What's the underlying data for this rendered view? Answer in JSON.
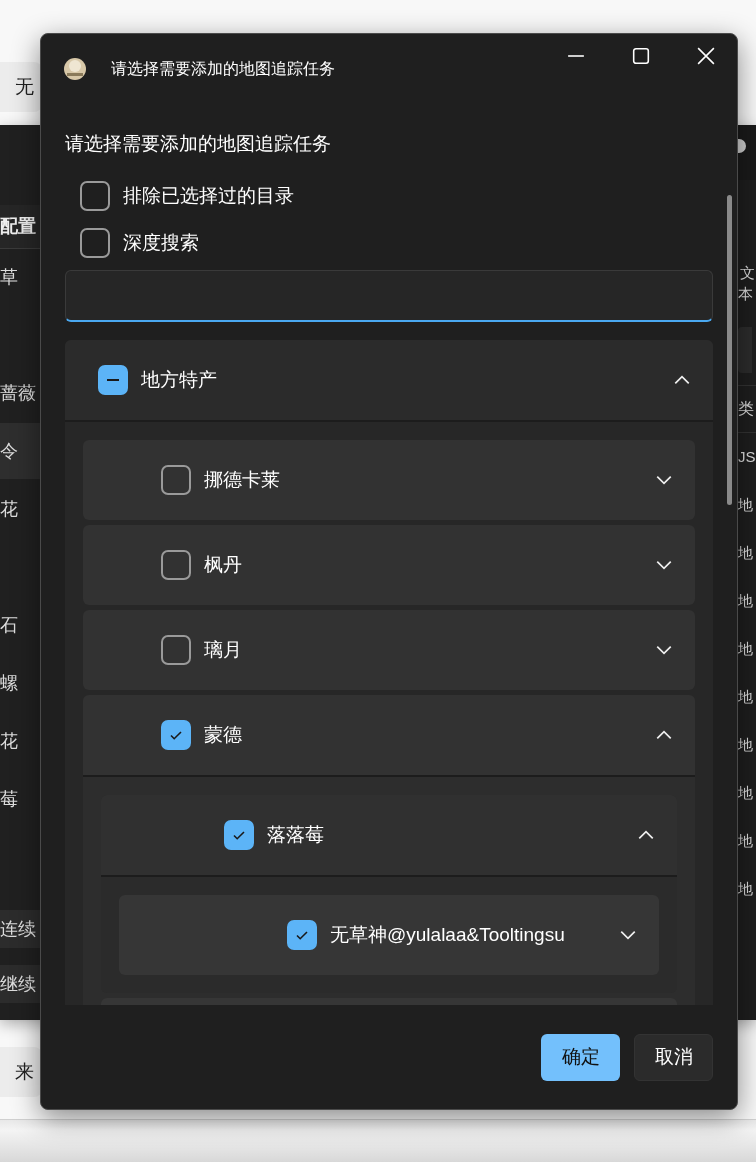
{
  "background": {
    "top_field": "无",
    "bottom_field": "来",
    "sidebar": {
      "header": "配置",
      "items": [
        {
          "label": "草",
          "selected": false
        },
        {
          "label": "蔷薇",
          "selected": false
        },
        {
          "label": "令",
          "selected": true
        },
        {
          "label": "花",
          "selected": false
        },
        {
          "label": "石",
          "selected": false
        },
        {
          "label": "螺",
          "selected": false
        },
        {
          "label": "花",
          "selected": false
        },
        {
          "label": "莓",
          "selected": false
        }
      ],
      "buttons": [
        "连续",
        "继续"
      ]
    },
    "right_panel": {
      "title": "文",
      "subtitle": "本",
      "column_header": "类",
      "rows": [
        "JS",
        "地",
        "地",
        "地",
        "地",
        "地",
        "地",
        "地",
        "地",
        "地"
      ]
    }
  },
  "dialog": {
    "title": "请选择需要添加的地图追踪任务",
    "heading": "请选择需要添加的地图追踪任务",
    "options": [
      {
        "label": "排除已选择过的目录",
        "checked": false
      },
      {
        "label": "深度搜索",
        "checked": false
      }
    ],
    "tree": [
      {
        "label": "地方特产",
        "indeterminate": true,
        "expanded": true,
        "children": [
          {
            "label": "挪德卡莱",
            "checked": false,
            "expanded": false
          },
          {
            "label": "枫丹",
            "checked": false,
            "expanded": false
          },
          {
            "label": "璃月",
            "checked": false,
            "expanded": false
          },
          {
            "label": "蒙德",
            "checked": true,
            "expanded": true,
            "children": [
              {
                "label": "落落莓",
                "checked": true,
                "expanded": true,
                "children": [
                  {
                    "label": "无草神@yulalaa&Tooltingsu",
                    "checked": true,
                    "expanded": false
                  }
                ]
              }
            ]
          }
        ]
      }
    ],
    "buttons": [
      {
        "label": "确定",
        "kind": "primary"
      },
      {
        "label": "取消",
        "kind": "secondary"
      }
    ]
  }
}
